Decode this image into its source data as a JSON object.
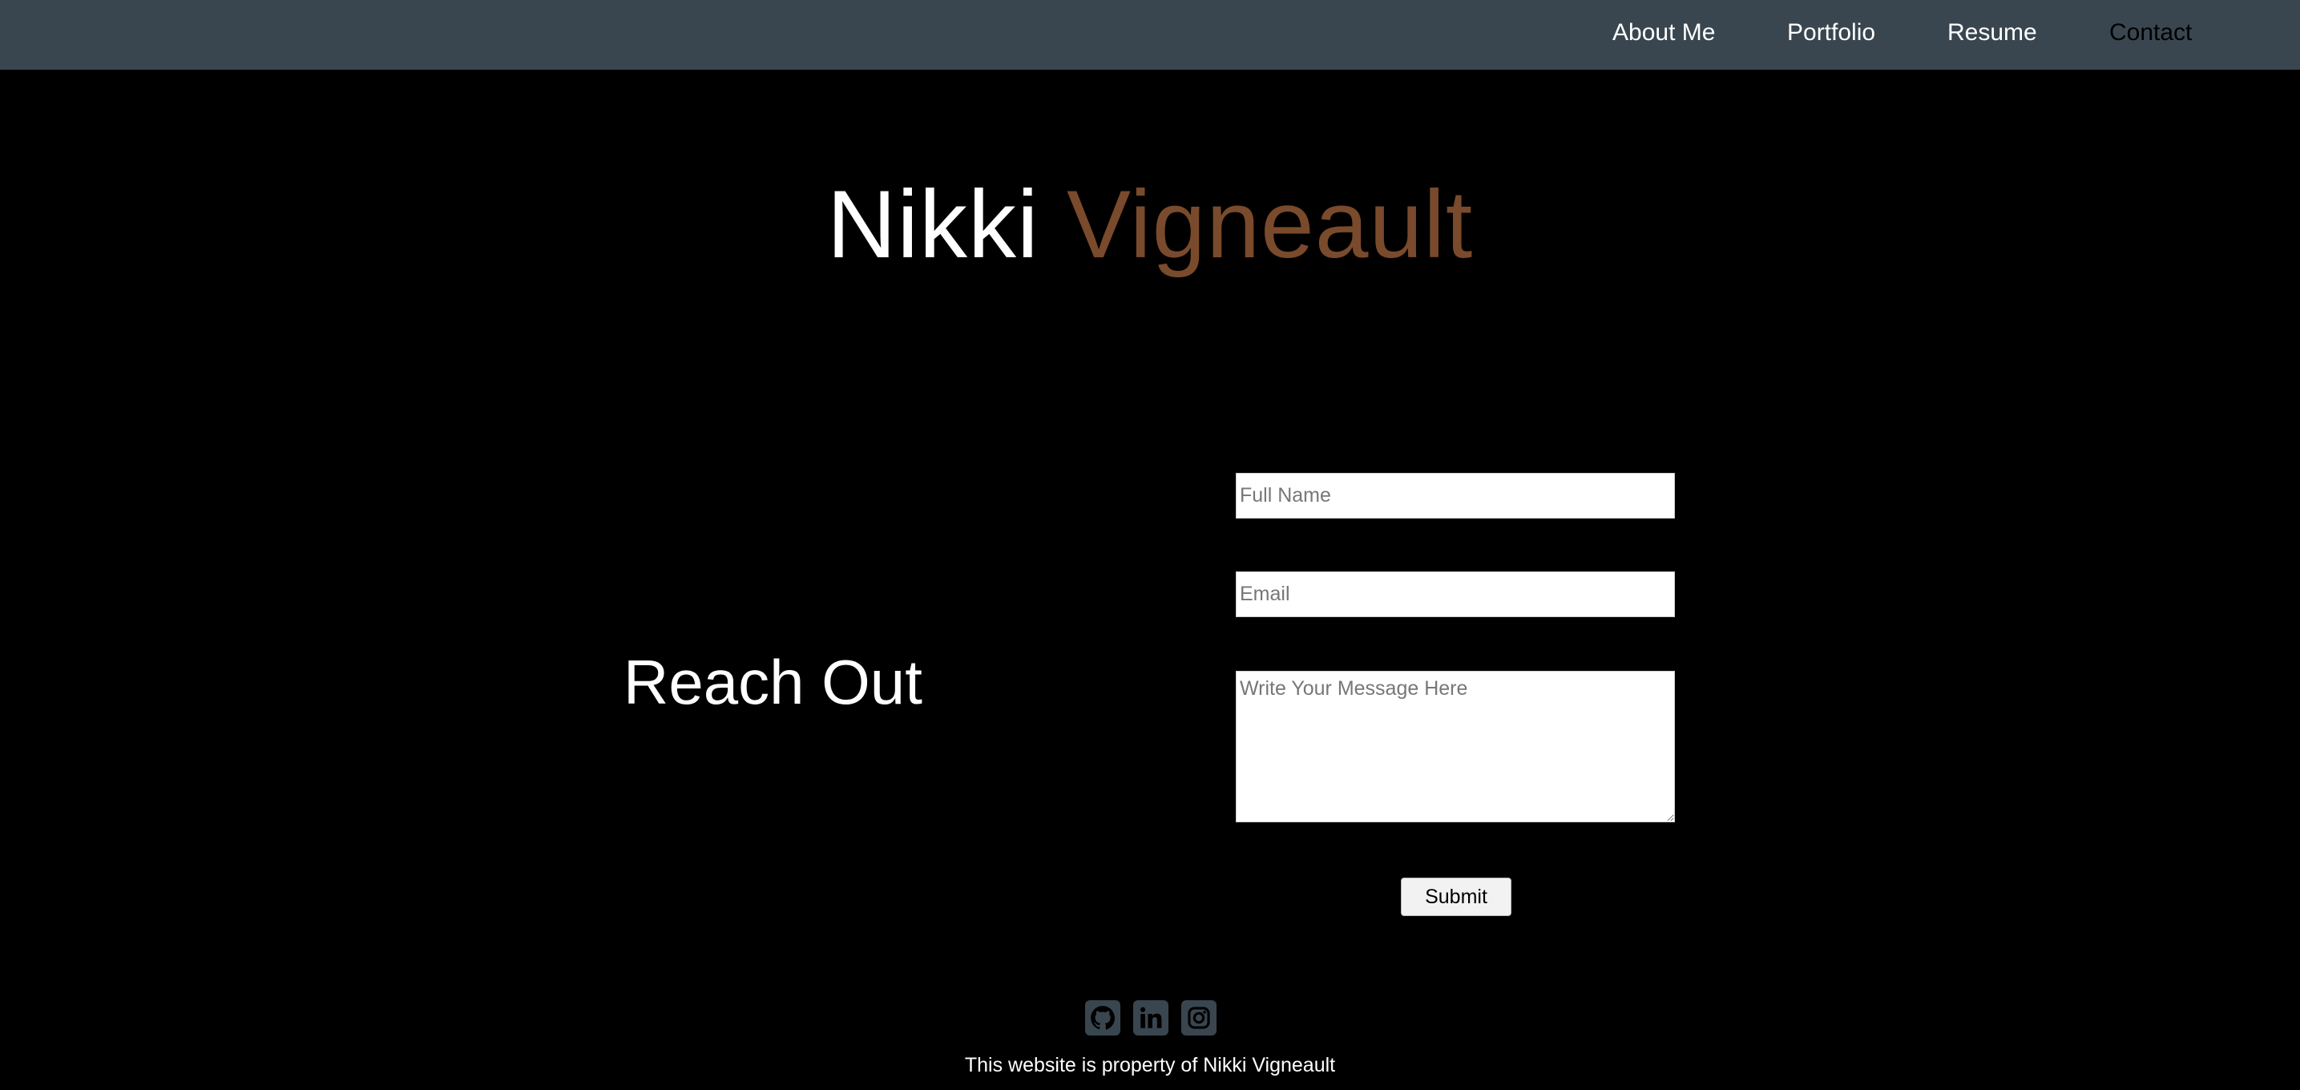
{
  "nav": {
    "links": [
      {
        "label": "About Me"
      },
      {
        "label": "Portfolio"
      },
      {
        "label": "Resume"
      },
      {
        "label": "Contact"
      }
    ],
    "active": "Contact"
  },
  "hero": {
    "first_name": "Nikki",
    "last_name": "Vigneault"
  },
  "contact": {
    "heading": "Reach Out",
    "full_name_placeholder": "Full Name",
    "email_placeholder": "Email",
    "message_placeholder": "Write Your Message Here",
    "submit_label": "Submit"
  },
  "footer": {
    "social_icons": [
      "github-icon",
      "linkedin-icon",
      "instagram-icon"
    ],
    "text": "This website is property of Nikki Vigneault"
  },
  "colors": {
    "nav_background": "#39464f",
    "page_background": "#000000",
    "accent": "#7a4a2c",
    "text": "#ffffff"
  }
}
